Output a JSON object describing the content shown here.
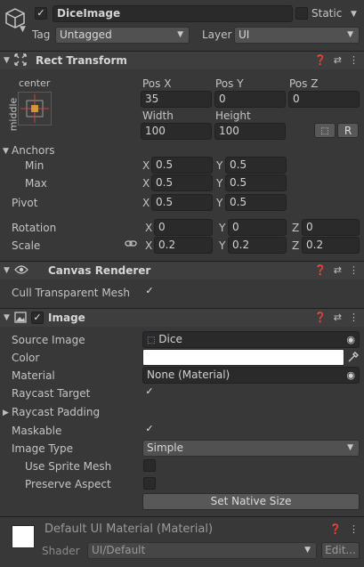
{
  "object": {
    "active": true,
    "name": "DiceImage",
    "static_label": "Static",
    "tag_label": "Tag",
    "tag_value": "Untagged",
    "layer_label": "Layer",
    "layer_value": "UI"
  },
  "rect_transform": {
    "title": "Rect Transform",
    "anchor_h": "center",
    "anchor_v": "middle",
    "pos_x_label": "Pos X",
    "pos_y_label": "Pos Y",
    "pos_z_label": "Pos Z",
    "pos_x": "35",
    "pos_y": "0",
    "pos_z": "0",
    "width_label": "Width",
    "height_label": "Height",
    "width": "100",
    "height": "100",
    "raw_label": "R",
    "anchors_label": "Anchors",
    "min_label": "Min",
    "max_label": "Max",
    "min_x": "0.5",
    "min_y": "0.5",
    "max_x": "0.5",
    "max_y": "0.5",
    "pivot_label": "Pivot",
    "pivot_x": "0.5",
    "pivot_y": "0.5",
    "rotation_label": "Rotation",
    "rot_x": "0",
    "rot_y": "0",
    "rot_z": "0",
    "scale_label": "Scale",
    "scale_x": "0.2",
    "scale_y": "0.2",
    "scale_z": "0.2",
    "x": "X",
    "y": "Y",
    "z": "Z"
  },
  "canvas_renderer": {
    "title": "Canvas Renderer",
    "cull_label": "Cull Transparent Mesh",
    "cull_checked": true
  },
  "image": {
    "title": "Image",
    "enabled": true,
    "source_image_label": "Source Image",
    "source_image_value": "Dice",
    "color_label": "Color",
    "color_value": "#ffffff",
    "material_label": "Material",
    "material_value": "None (Material)",
    "raycast_target_label": "Raycast Target",
    "raycast_padding_label": "Raycast Padding",
    "maskable_label": "Maskable",
    "image_type_label": "Image Type",
    "image_type_value": "Simple",
    "use_sprite_mesh_label": "Use Sprite Mesh",
    "preserve_aspect_label": "Preserve Aspect",
    "set_native_size_label": "Set Native Size"
  },
  "material_footer": {
    "title": "Default UI Material (Material)",
    "shader_label": "Shader",
    "shader_value": "UI/Default",
    "edit_label": "Edit..."
  }
}
